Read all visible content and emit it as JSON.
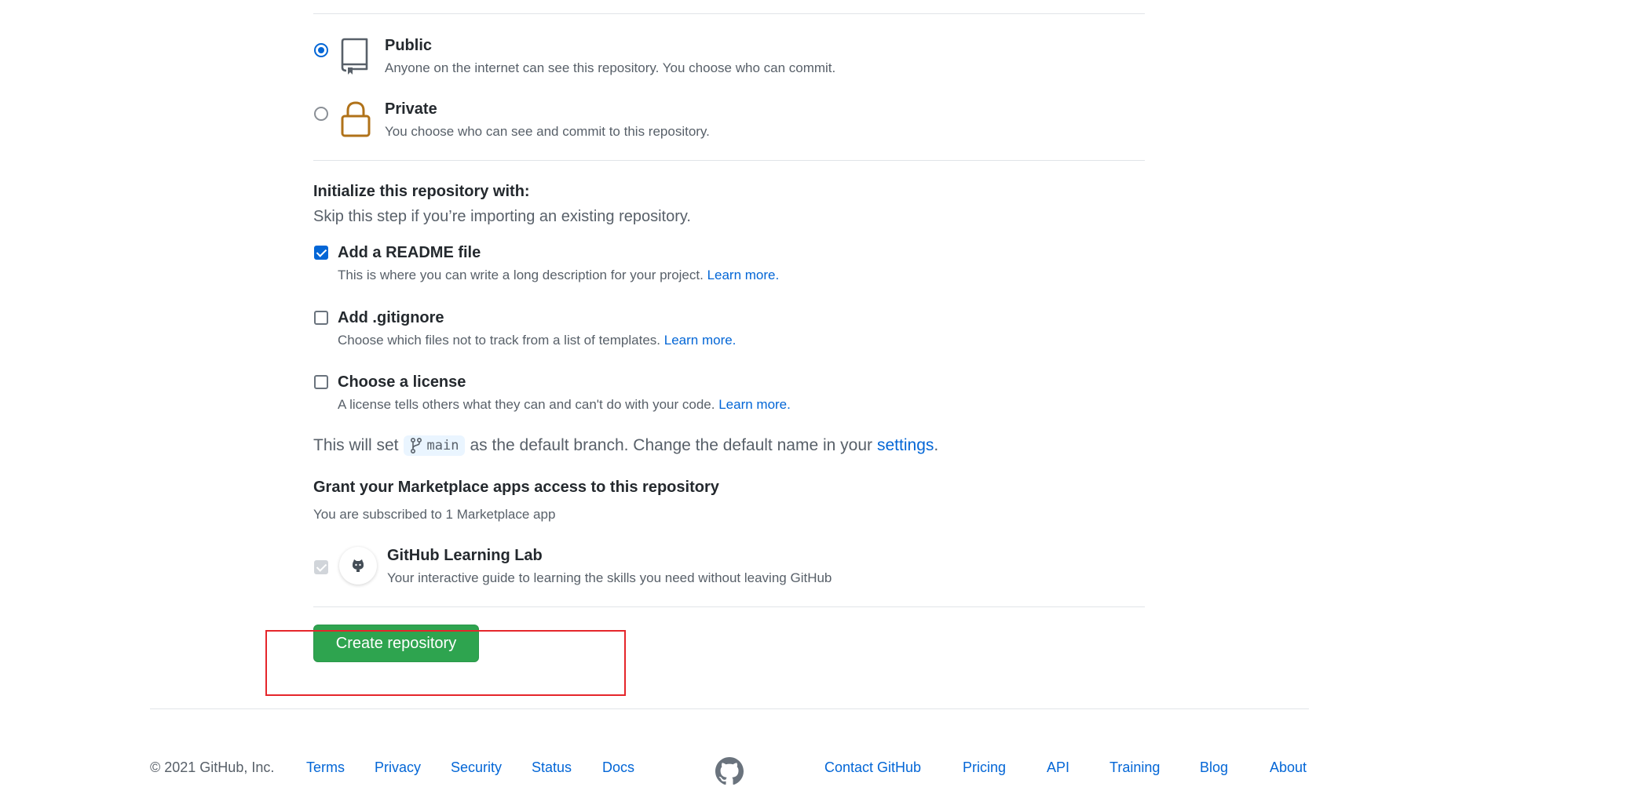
{
  "visibility": {
    "public": {
      "title": "Public",
      "description": "Anyone on the internet can see this repository. You choose who can commit.",
      "selected": true,
      "icon": "repo-icon"
    },
    "private": {
      "title": "Private",
      "description": "You choose who can see and commit to this repository.",
      "selected": false,
      "icon": "lock-icon"
    }
  },
  "initialize": {
    "heading": "Initialize this repository with:",
    "subheading": "Skip this step if you’re importing an existing repository.",
    "readme": {
      "title": "Add a README file",
      "description": "This is where you can write a long description for your project.",
      "link": "Learn more.",
      "checked": true
    },
    "gitignore": {
      "title": "Add .gitignore",
      "description": "Choose which files not to track from a list of templates.",
      "link": "Learn more.",
      "checked": false
    },
    "license": {
      "title": "Choose a license",
      "description": "A license tells others what they can and can't do with your code.",
      "link": "Learn more.",
      "checked": false
    }
  },
  "branch": {
    "prefix": "This will set",
    "name": "main",
    "suffix": "as the default branch. Change the default name in your",
    "settings_link": "settings",
    "period": "."
  },
  "marketplace": {
    "heading": "Grant your Marketplace apps access to this repository",
    "subheading": "You are subscribed to 1 Marketplace app",
    "app": {
      "name": "GitHub Learning Lab",
      "description": "Your interactive guide to learning the skills you need without leaving GitHub",
      "checked": true,
      "disabled": true
    }
  },
  "actions": {
    "create_label": "Create repository"
  },
  "footer": {
    "copyright": "© 2021 GitHub, Inc.",
    "left_links": [
      "Terms",
      "Privacy",
      "Security",
      "Status",
      "Docs"
    ],
    "right_links": [
      "Contact GitHub",
      "Pricing",
      "API",
      "Training",
      "Blog",
      "About"
    ]
  },
  "colors": {
    "accent": "#0366d6",
    "primary_button": "#2ea44f",
    "highlight": "#e5262b"
  }
}
